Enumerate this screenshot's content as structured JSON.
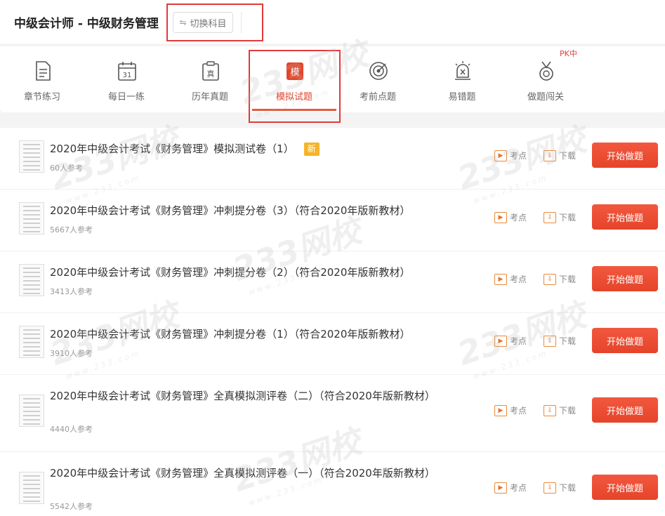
{
  "header": {
    "title": "中级会计师 - 中级财务管理",
    "switch_icon": "⇋",
    "switch_label": "切换科目"
  },
  "tabs": [
    {
      "label": "章节练习",
      "icon": "document-icon"
    },
    {
      "label": "每日一练",
      "icon": "calendar-icon",
      "icon_text": "31"
    },
    {
      "label": "历年真题",
      "icon": "clipboard-icon",
      "icon_text": "真"
    },
    {
      "label": "模拟试题",
      "icon": "exam-icon",
      "icon_text": "模",
      "active": true
    },
    {
      "label": "考前点题",
      "icon": "target-icon"
    },
    {
      "label": "易错题",
      "icon": "alarm-icon"
    },
    {
      "label": "做题闯关",
      "icon": "medal-icon"
    }
  ],
  "pk_badge": "PK中",
  "watermark": {
    "brand": "233网校",
    "url": "www.233.com"
  },
  "actions": {
    "kaodian": "考点",
    "xiazai": "下载",
    "start": "开始做题",
    "play_glyph": "▶",
    "download_glyph": "⇩"
  },
  "items": [
    {
      "title": "2020年中级会计考试《财务管理》模拟测试卷（1）",
      "badge": "新",
      "count": "60人参考"
    },
    {
      "title": "2020年中级会计考试《财务管理》冲刺提分卷（3）（符合2020年版新教材）",
      "count": "5667人参考"
    },
    {
      "title": "2020年中级会计考试《财务管理》冲刺提分卷（2）（符合2020年版新教材）",
      "count": "3413人参考"
    },
    {
      "title": "2020年中级会计考试《财务管理》冲刺提分卷（1）（符合2020年版新教材）",
      "count": "3910人参考"
    },
    {
      "title": "2020年中级会计考试《财务管理》全真模拟测评卷（二）（符合2020年版新教材）",
      "count": "4440人参考"
    },
    {
      "title": "2020年中级会计考试《财务管理》全真模拟测评卷（一）（符合2020年版新教材）",
      "count": "5542人参考"
    }
  ],
  "colors": {
    "accent": "#e5442a",
    "badge": "#f5b42b",
    "highlight_box": "#e23a3a"
  }
}
